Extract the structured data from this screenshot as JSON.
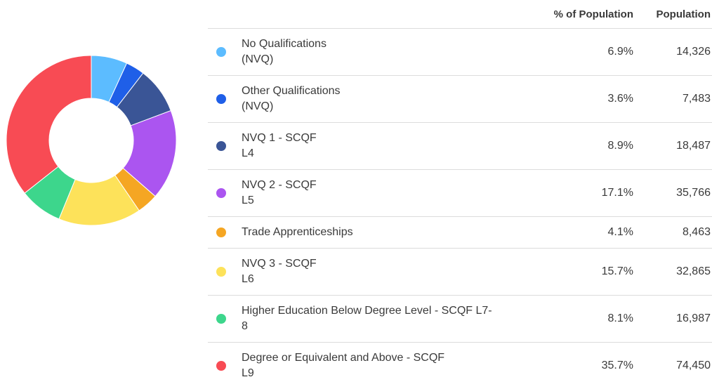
{
  "chart_data": {
    "type": "pie",
    "donut": true,
    "columns": {
      "percent": "% of Population",
      "population": "Population"
    },
    "categories": [
      "No Qualifications (NVQ)",
      "Other Qualifications (NVQ)",
      "NVQ 1 - SCQF L4",
      "NVQ 2 - SCQF L5",
      "Trade Apprenticeships",
      "NVQ 3 - SCQF L6",
      "Higher Education Below Degree Level - SCQF L7-8",
      "Degree or Equivalent and Above - SCQF L9"
    ],
    "label_lines": [
      [
        "No Qualifications",
        "(NVQ)"
      ],
      [
        "Other Qualifications",
        "(NVQ)"
      ],
      [
        "NVQ 1 - SCQF",
        "L4"
      ],
      [
        "NVQ 2 - SCQF",
        "L5"
      ],
      [
        "Trade Apprenticeships"
      ],
      [
        "NVQ 3 - SCQF",
        "L6"
      ],
      [
        "Higher Education Below Degree Level - SCQF L7-",
        "8"
      ],
      [
        "Degree or Equivalent and Above - SCQF",
        "L9"
      ]
    ],
    "percent_labels": [
      "6.9%",
      "3.6%",
      "8.9%",
      "17.1%",
      "4.1%",
      "15.7%",
      "8.1%",
      "35.7%"
    ],
    "population_labels": [
      "14,326",
      "7,483",
      "18,487",
      "35,766",
      "8,463",
      "32,865",
      "16,987",
      "74,450"
    ],
    "values": [
      14326,
      7483,
      18487,
      35766,
      8463,
      32865,
      16987,
      74450
    ],
    "colors": [
      "#5cbcff",
      "#1f5fe8",
      "#3a5596",
      "#ab55f0",
      "#f5a623",
      "#fde25a",
      "#3dd68c",
      "#f84b54"
    ]
  }
}
